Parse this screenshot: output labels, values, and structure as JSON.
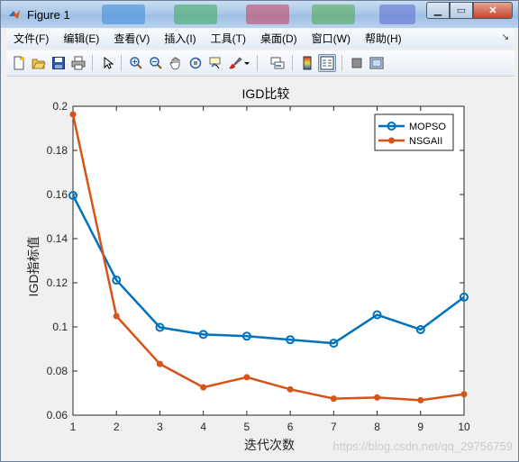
{
  "window": {
    "title": "Figure 1"
  },
  "menu": [
    "文件(F)",
    "编辑(E)",
    "查看(V)",
    "插入(I)",
    "工具(T)",
    "桌面(D)",
    "窗口(W)",
    "帮助(H)"
  ],
  "toolbar_icons": [
    "new-figure-icon",
    "open-file-icon",
    "save-icon",
    "print-icon",
    "pointer-icon",
    "zoom-in-icon",
    "zoom-out-icon",
    "pan-icon",
    "rotate-3d-icon",
    "data-cursor-icon",
    "brush-icon",
    "link-plot-icon",
    "colorbar-icon",
    "legend-icon",
    "hide-plot-tools-icon",
    "show-plot-tools-icon"
  ],
  "chart_data": {
    "type": "line",
    "title": "IGD比较",
    "xlabel": "迭代次数",
    "ylabel": "IGD指标值",
    "x": [
      1,
      2,
      3,
      4,
      5,
      6,
      7,
      8,
      9,
      10
    ],
    "xlim": [
      1,
      10
    ],
    "ylim": [
      0.06,
      0.2
    ],
    "xticks": [
      "1",
      "2",
      "3",
      "4",
      "5",
      "6",
      "7",
      "8",
      "9",
      "10"
    ],
    "yticks": [
      "0.06",
      "0.08",
      "0.1",
      "0.12",
      "0.14",
      "0.16",
      "0.18",
      "0.2"
    ],
    "yticks_values": [
      0.06,
      0.08,
      0.1,
      0.12,
      0.14,
      0.16,
      0.18,
      0.2
    ],
    "legend_position": "top-right",
    "grid": false,
    "series": [
      {
        "name": "MOPSO",
        "marker": "circle-open",
        "color": "#0072BD",
        "values": [
          0.1596,
          0.1212,
          0.0998,
          0.0966,
          0.0958,
          0.0942,
          0.0926,
          0.1055,
          0.0988,
          0.1135
        ]
      },
      {
        "name": "NSGAII",
        "marker": "dot",
        "color": "#D95319",
        "values": [
          0.1963,
          0.1049,
          0.0832,
          0.0726,
          0.0772,
          0.0717,
          0.0675,
          0.068,
          0.0668,
          0.0695
        ]
      }
    ]
  },
  "watermark": "https://blog.csdn.net/qq_29756759"
}
